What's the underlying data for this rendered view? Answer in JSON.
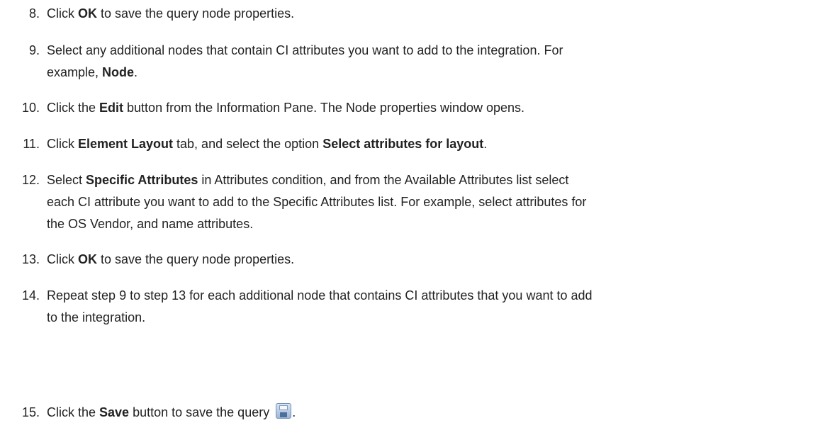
{
  "steps": [
    {
      "num": "8.",
      "parts": [
        "Click ",
        "OK",
        " to save the query node properties."
      ]
    },
    {
      "num": "9.",
      "line1": [
        "Select any additional nodes that contain CI attributes you want to add to the integration. For"
      ],
      "line2": [
        "example, ",
        "Node",
        "."
      ]
    },
    {
      "num": "10.",
      "parts": [
        "Click the ",
        "Edit",
        " button from the Information Pane. The Node properties window opens."
      ]
    },
    {
      "num": "11.",
      "parts": [
        "Click ",
        "Element Layout",
        " tab, and select the option ",
        "Select attributes for layout",
        "."
      ]
    },
    {
      "num": "12.",
      "line1": [
        "Select ",
        "Specific Attributes",
        " in Attributes condition, and from the Available Attributes list select"
      ],
      "line2": "each CI attribute you want to add to the Specific Attributes list. For example, select attributes for",
      "line3": "the OS Vendor, and name attributes."
    },
    {
      "num": "13.",
      "parts": [
        "Click ",
        "OK",
        " to save the query node properties."
      ]
    },
    {
      "num": "14.",
      "line1": "Repeat step 9 to step 13 for each additional node that contains CI attributes that you want to add",
      "line2": "to the integration."
    },
    {
      "num": "15.",
      "parts": [
        "Click the ",
        "Save",
        " button to save the query ",
        "."
      ],
      "icon": "save-icon"
    }
  ]
}
